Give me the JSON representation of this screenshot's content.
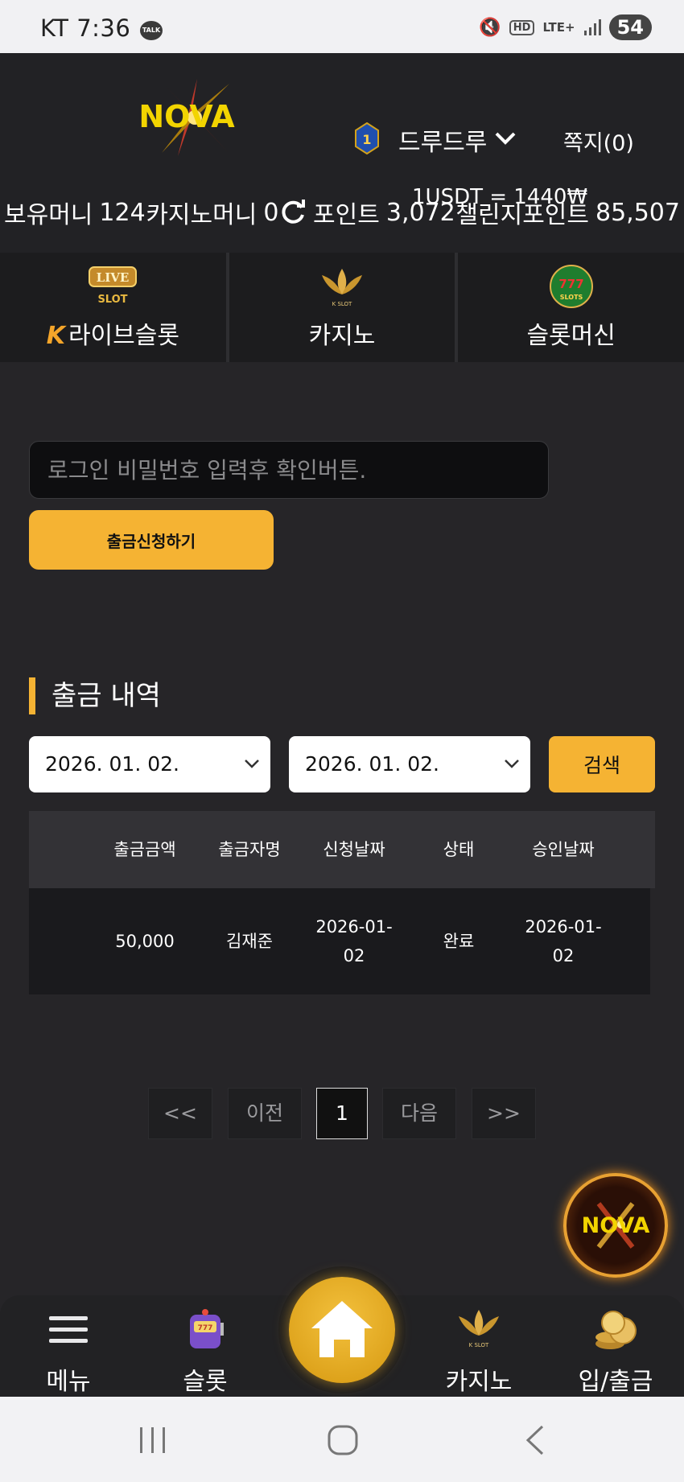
{
  "status_bar": {
    "carrier": "KT",
    "time": "7:36",
    "talk_badge": "TALK",
    "hd_label": "HD",
    "network": "LTE+",
    "battery": "54"
  },
  "header": {
    "logo_text": "NOVA",
    "rank_number": "1",
    "username": "드루드루",
    "messages": "쪽지(0)",
    "exchange_rate": "1USDT = 1440₩"
  },
  "balances": {
    "money_label": "보유머니",
    "money_value": "124",
    "casino_label": "카지노머니",
    "casino_value": "0",
    "point_label": "포인트",
    "point_value": "3,072",
    "challenge_label": "챌린지포인트",
    "challenge_value": "85,507"
  },
  "game_tabs": [
    {
      "icon": "live-slot-icon",
      "prefix": "K",
      "label": "라이브슬롯"
    },
    {
      "icon": "k-slot-lotus-icon",
      "label": "카지노"
    },
    {
      "icon": "777-slots-icon",
      "label": "슬롯머신"
    }
  ],
  "withdraw_form": {
    "password_placeholder": "로그인 비밀번호 입력후 확인버튼.",
    "submit_label": "출금신청하기"
  },
  "history": {
    "title": "출금 내역",
    "date_from": "2026. 01. 02.",
    "date_to": "2026. 01. 02.",
    "search_label": "검색",
    "columns": [
      "출금금액",
      "출금자명",
      "신청날짜",
      "상태",
      "승인날짜"
    ],
    "rows": [
      {
        "amount": "50,000",
        "name": "김재준",
        "request_date_1": "2026-01-",
        "request_date_2": "02",
        "status": "완료",
        "approve_date_1": "2026-01-",
        "approve_date_2": "02"
      }
    ]
  },
  "pagination": {
    "first": "<<",
    "prev": "이전",
    "current": "1",
    "next": "다음",
    "last": ">>"
  },
  "bottom_nav": [
    {
      "icon": "hamburger-menu-icon",
      "label": "메뉴"
    },
    {
      "icon": "slot-machine-icon",
      "label": "슬롯"
    },
    {
      "icon": "home-icon",
      "label": ""
    },
    {
      "icon": "k-slot-lotus-icon",
      "label": "카지노"
    },
    {
      "icon": "coins-icon",
      "label": "입/출금"
    }
  ],
  "colors": {
    "accent": "#f5b333",
    "background": "#262528",
    "header": "#222225"
  }
}
